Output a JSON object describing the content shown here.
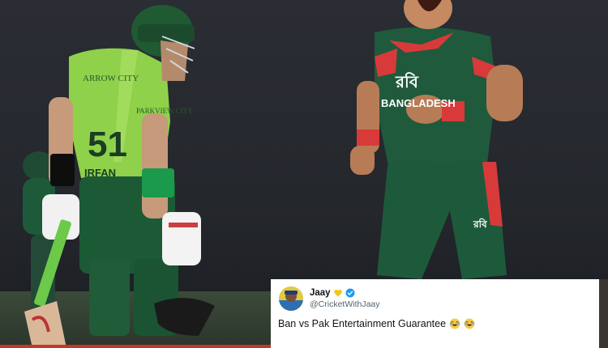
{
  "photo": {
    "jersey_left_number": "51",
    "jersey_left_sponsor": "ARROW CITY",
    "jersey_left_sponsor2": "PARKVIEW CITY",
    "jersey_left_name": "IRFAN",
    "jersey_right_text1": "রবি",
    "jersey_right_text2": "BANGLADESH",
    "short_logo_text": "রবি"
  },
  "tweet": {
    "display_name": "Jaay",
    "handle": "@CricketWithJaay",
    "text": "Ban vs Pak Entertainment Guarantee",
    "emojis": [
      "laughing-emoji",
      "laughing-emoji"
    ],
    "accent_colors": {
      "verified": "#1d9bf0",
      "heart": "#f5c518"
    }
  }
}
